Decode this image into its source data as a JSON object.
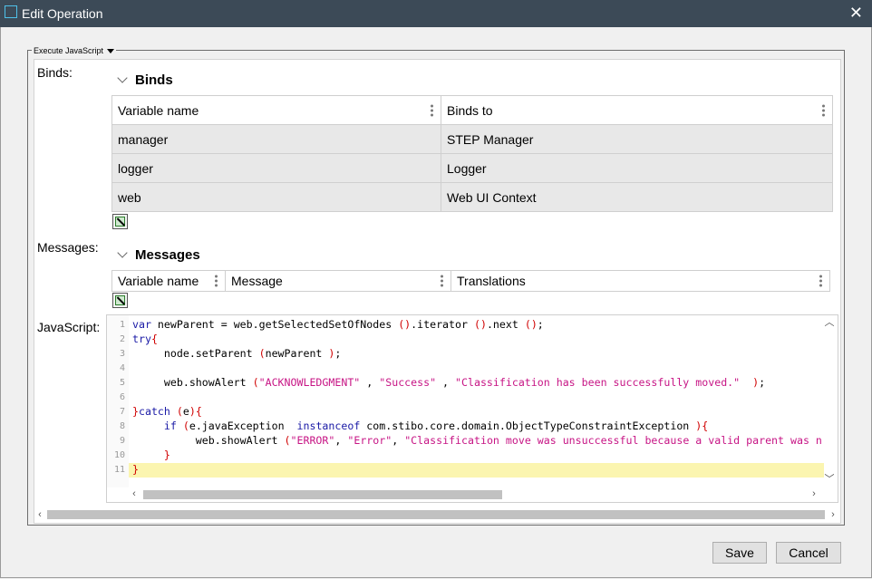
{
  "window": {
    "title": "Edit Operation",
    "close_glyph": "✕"
  },
  "group": {
    "legend": "Execute JavaScript"
  },
  "labels": {
    "binds": "Binds:",
    "messages": "Messages:",
    "javascript": "JavaScript:"
  },
  "binds_section": {
    "title": "Binds",
    "columns": [
      "Variable name",
      "Binds to"
    ],
    "rows": [
      [
        "manager",
        "STEP Manager"
      ],
      [
        "logger",
        "Logger"
      ],
      [
        "web",
        "Web UI Context"
      ]
    ]
  },
  "messages_section": {
    "title": "Messages",
    "columns": [
      "Variable name",
      "Message",
      "Translations"
    ]
  },
  "code": {
    "line_numbers": [
      "1",
      "2",
      "3",
      "4",
      "5",
      "6",
      "7",
      "8",
      "9",
      "10",
      "11"
    ],
    "lines": [
      "var newParent = web.getSelectedSetOfNodes ().iterator ().next ();",
      "try{",
      "     node.setParent (newParent );",
      "",
      "     web.showAlert (\"ACKNOWLEDGMENT\" , \"Success\" , \"Classification has been successfully moved.\"  );",
      "",
      "}catch (e){",
      "     if (e.javaException  instanceof com.stibo.core.domain.ObjectTypeConstraintException ){",
      "          web.showAlert (\"ERROR\", \"Error\", \"Classification move was unsuccessful because a valid parent was n",
      "     }",
      "}"
    ]
  },
  "buttons": {
    "save": "Save",
    "cancel": "Cancel"
  },
  "colors": {
    "titlebar": "#3c4a57",
    "keyword": "#1a1aa6",
    "string": "#c71585",
    "bracket": "#d00000",
    "current_line": "#fbf5b0"
  }
}
